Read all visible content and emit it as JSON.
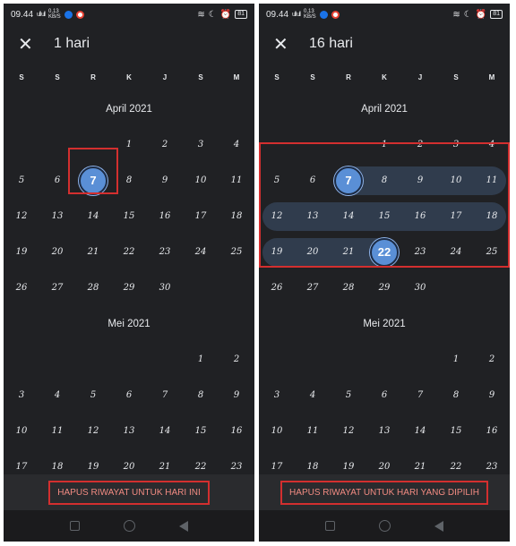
{
  "status": {
    "time": "09.44",
    "netspeed_top": "0,13",
    "netspeed_bottom": "KB/S",
    "signal": "ull ull",
    "battery": "81"
  },
  "colors": {
    "background": "#202124",
    "selected": "#5a8fd6",
    "range": "#303c4d",
    "accent_red": "#f28b82",
    "annotation": "#d32f2f"
  },
  "left": {
    "title": "1 hari",
    "weekdays": [
      "S",
      "S",
      "R",
      "K",
      "J",
      "S",
      "M"
    ],
    "months": [
      {
        "name": "April 2021",
        "weeks": [
          [
            "",
            "",
            "",
            "1",
            "2",
            "3",
            "4"
          ],
          [
            "5",
            "6",
            "7",
            "8",
            "9",
            "10",
            "11"
          ],
          [
            "12",
            "13",
            "14",
            "15",
            "16",
            "17",
            "18"
          ],
          [
            "19",
            "20",
            "21",
            "22",
            "23",
            "24",
            "25"
          ],
          [
            "26",
            "27",
            "28",
            "29",
            "30",
            "",
            ""
          ]
        ]
      },
      {
        "name": "Mei 2021",
        "weeks": [
          [
            "",
            "",
            "",
            "",
            "",
            "1",
            "2"
          ],
          [
            "3",
            "4",
            "5",
            "6",
            "7",
            "8",
            "9"
          ],
          [
            "10",
            "11",
            "12",
            "13",
            "14",
            "15",
            "16"
          ],
          [
            "17",
            "18",
            "19",
            "20",
            "21",
            "22",
            "23"
          ]
        ]
      }
    ],
    "selected_day": "7",
    "clear_button": "HAPUS RIWAYAT UNTUK HARI INI"
  },
  "right": {
    "title": "16 hari",
    "weekdays": [
      "S",
      "S",
      "R",
      "K",
      "J",
      "S",
      "M"
    ],
    "months": [
      {
        "name": "April 2021",
        "weeks": [
          [
            "",
            "",
            "",
            "1",
            "2",
            "3",
            "4"
          ],
          [
            "5",
            "6",
            "7",
            "8",
            "9",
            "10",
            "11"
          ],
          [
            "12",
            "13",
            "14",
            "15",
            "16",
            "17",
            "18"
          ],
          [
            "19",
            "20",
            "21",
            "22",
            "23",
            "24",
            "25"
          ],
          [
            "26",
            "27",
            "28",
            "29",
            "30",
            "",
            ""
          ]
        ]
      },
      {
        "name": "Mei 2021",
        "weeks": [
          [
            "",
            "",
            "",
            "",
            "",
            "1",
            "2"
          ],
          [
            "3",
            "4",
            "5",
            "6",
            "7",
            "8",
            "9"
          ],
          [
            "10",
            "11",
            "12",
            "13",
            "14",
            "15",
            "16"
          ],
          [
            "17",
            "18",
            "19",
            "20",
            "21",
            "22",
            "23"
          ]
        ]
      }
    ],
    "range_start": "7",
    "range_end": "22",
    "clear_button": "HAPUS RIWAYAT UNTUK HARI YANG DIPILIH"
  }
}
